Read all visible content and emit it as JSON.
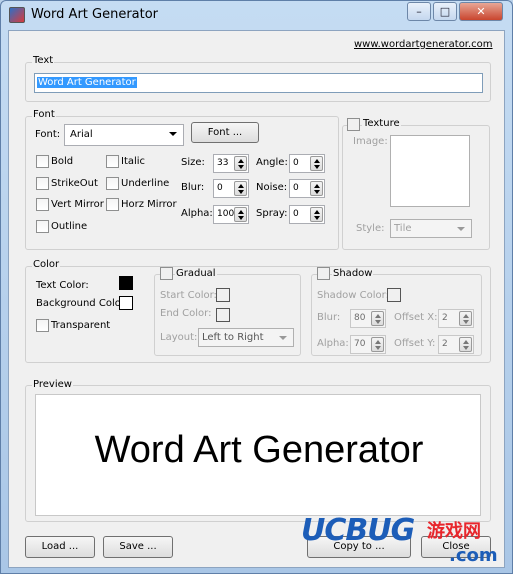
{
  "window": {
    "title": "Word Art Generator",
    "minimize": "–",
    "maximize": "□",
    "close": "✕"
  },
  "link": "www.wordartgenerator.com",
  "text_group": {
    "label": "Text",
    "value": "Word Art Generator"
  },
  "font_group": {
    "label": "Font",
    "font_label": "Font:",
    "font_value": "Arial",
    "font_button": "Font ...",
    "checkboxes": [
      "Bold",
      "Italic",
      "StrikeOut",
      "Underline",
      "Vert Mirror",
      "Horz Mirror",
      "Outline"
    ],
    "size": {
      "label": "Size:",
      "value": "33"
    },
    "angle": {
      "label": "Angle:",
      "value": "0"
    },
    "blur": {
      "label": "Blur:",
      "value": "0"
    },
    "noise": {
      "label": "Noise:",
      "value": "0"
    },
    "alpha": {
      "label": "Alpha:",
      "value": "100"
    },
    "spray": {
      "label": "Spray:",
      "value": "0"
    }
  },
  "texture_group": {
    "label": "Texture",
    "image_label": "Image:",
    "style_label": "Style:",
    "style_value": "Tile"
  },
  "color_group": {
    "label": "Color",
    "text_color_label": "Text Color:",
    "background_color_label": "Background Color",
    "transparent_label": "Transparent",
    "text_color": "#000000",
    "background_color": "#ffffff"
  },
  "gradual_group": {
    "label": "Gradual",
    "start_label": "Start Color:",
    "end_label": "End Color:",
    "layout_label": "Layout:",
    "layout_value": "Left to Right"
  },
  "shadow_group": {
    "label": "Shadow",
    "color_label": "Shadow Color:",
    "blur": {
      "label": "Blur:",
      "value": "80"
    },
    "alpha": {
      "label": "Alpha:",
      "value": "70"
    },
    "offset_x": {
      "label": "Offset X:",
      "value": "2"
    },
    "offset_y": {
      "label": "Offset Y:",
      "value": "2"
    }
  },
  "preview_group": {
    "label": "Preview",
    "text": "Word Art Generator"
  },
  "buttons": {
    "load": "Load ...",
    "save": "Save ...",
    "copy": "Copy to ...",
    "close": "Close"
  },
  "watermark": {
    "brand": "UCBUG",
    "cn": "游戏网",
    "domain": ".com"
  },
  "colors": {
    "accent_selection": "#3399ff",
    "watermark_red": "#e8262c",
    "watermark_blue": "#1c5db8"
  }
}
